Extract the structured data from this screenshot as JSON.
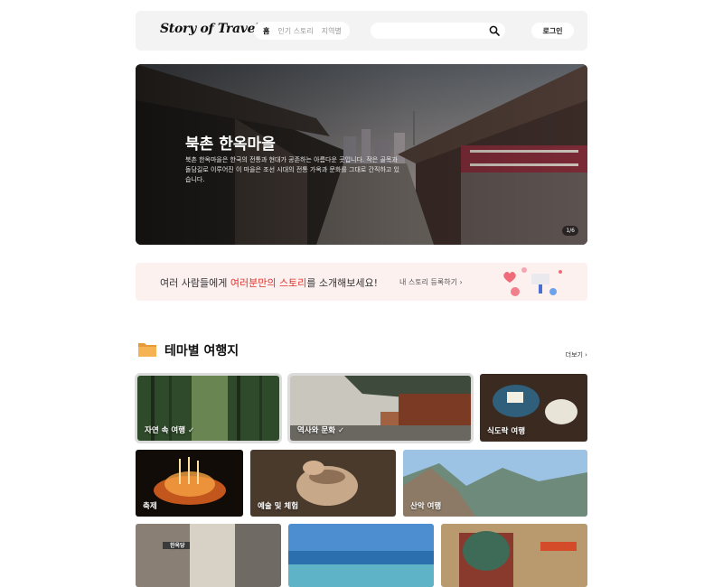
{
  "header": {
    "logo": "Story of Travel",
    "nav": [
      "홈",
      "인기 스토리",
      "지역별"
    ],
    "search_placeholder": "",
    "login": "로그인"
  },
  "hero": {
    "title": "북촌 한옥마을",
    "description": "북촌 한옥마을은 한국의 전통과 현대가 공존하는 아름다운 곳입니다. 작은 골목과 돌담길로 이루어진 이 마을은 조선 시대의 전통 가옥과 문화를 그대로 간직하고 있습니다.",
    "counter": "1/6"
  },
  "banner": {
    "text_before": "여러 사람들에게 ",
    "text_highlight": "여러분만의 스토리",
    "text_after": "를 소개해보세요!",
    "link": "내 스토리 등록하기 ›"
  },
  "section": {
    "title": "테마별 여행지",
    "more": "더보기 ›"
  },
  "themes": [
    "자연 속 여행 ✓",
    "역사와 문화 ✓",
    "식도락 여행",
    "축제",
    "예술 및 체험",
    "산악 여행",
    "",
    "",
    ""
  ],
  "sign_text": "한옥당",
  "colors": {
    "accent_red": "#e0332b",
    "header_bg": "#f3f3f3",
    "banner_bg": "#fdf1f0"
  }
}
